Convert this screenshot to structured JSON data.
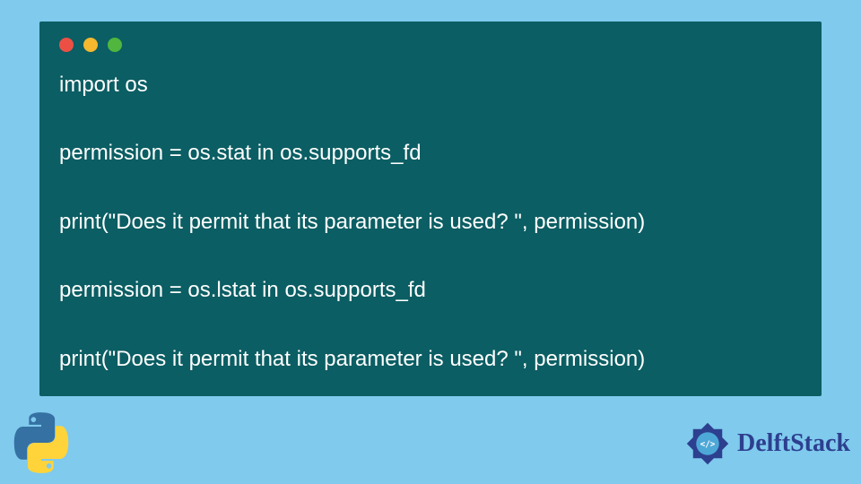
{
  "code": {
    "line1": "import os",
    "line2": "permission = os.stat in os.supports_fd",
    "line3": "print(\"Does it permit that its parameter is used? \", permission)",
    "line4": "permission = os.lstat in os.supports_fd",
    "line5": "print(\"Does it permit that its parameter is used? \", permission)"
  },
  "brand": {
    "name": "DelftStack"
  }
}
